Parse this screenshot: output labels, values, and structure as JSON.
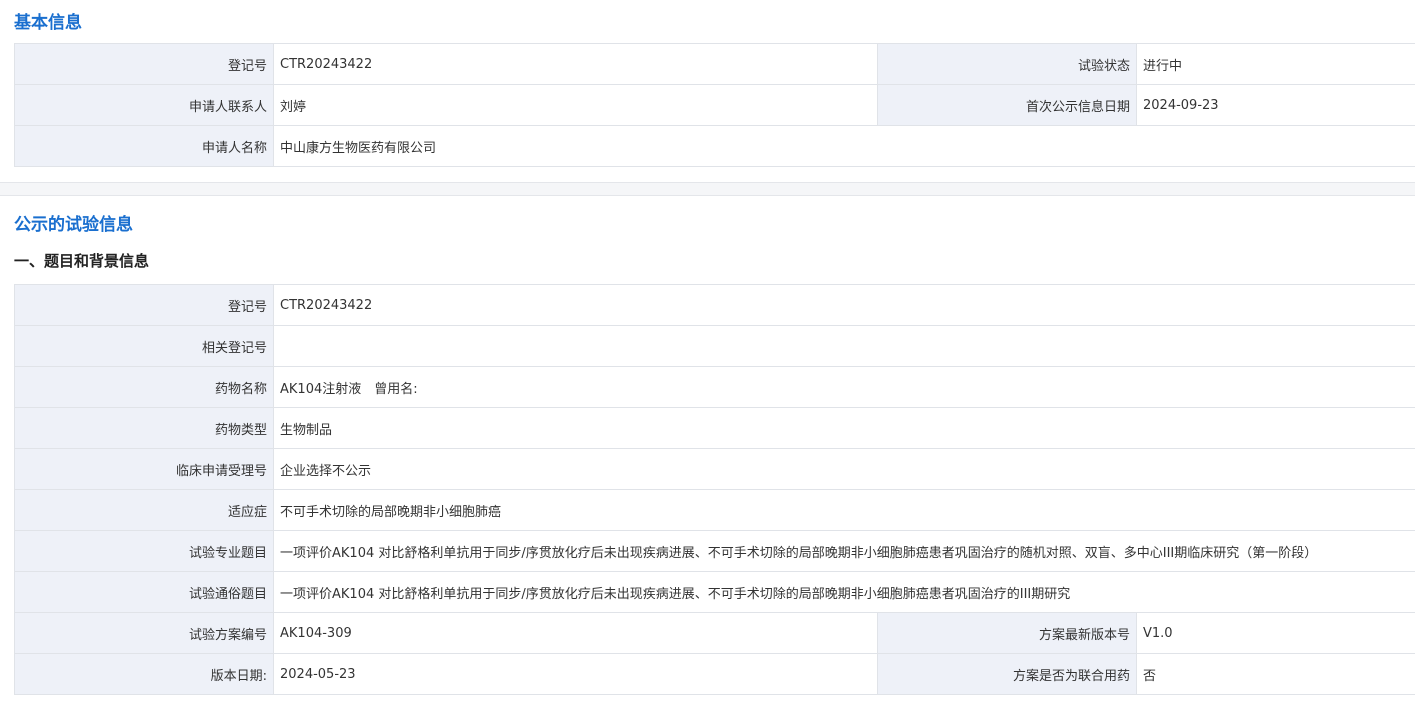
{
  "basic": {
    "title": "基本信息",
    "rows": [
      {
        "label": "登记号",
        "value": "CTR20243422",
        "label2": "试验状态",
        "value2": "进行中"
      },
      {
        "label": "申请人联系人",
        "value": "刘婷",
        "label2": "首次公示信息日期",
        "value2": "2024-09-23"
      },
      {
        "label": "申请人名称",
        "value": "中山康方生物医药有限公司"
      }
    ]
  },
  "trial": {
    "title": "公示的试验信息",
    "subtitle": "一、题目和背景信息",
    "rows": [
      {
        "label": "登记号",
        "value": "CTR20243422"
      },
      {
        "label": "相关登记号",
        "value": ""
      },
      {
        "label": "药物名称",
        "value": "AK104注射液　曾用名:"
      },
      {
        "label": "药物类型",
        "value": "生物制品"
      },
      {
        "label": "临床申请受理号",
        "value": "企业选择不公示"
      },
      {
        "label": "适应症",
        "value": "不可手术切除的局部晚期非小细胞肺癌"
      },
      {
        "label": "试验专业题目",
        "value": "一项评价AK104 对比舒格利单抗用于同步/序贯放化疗后未出现疾病进展、不可手术切除的局部晚期非小细胞肺癌患者巩固治疗的随机对照、双盲、多中心III期临床研究（第一阶段）"
      },
      {
        "label": "试验通俗题目",
        "value": "一项评价AK104 对比舒格利单抗用于同步/序贯放化疗后未出现疾病进展、不可手术切除的局部晚期非小细胞肺癌患者巩固治疗的III期研究"
      },
      {
        "label": "试验方案编号",
        "value": "AK104-309",
        "label2": "方案最新版本号",
        "value2": "V1.0"
      },
      {
        "label": "版本日期:",
        "value": "2024-05-23",
        "label2": "方案是否为联合用药",
        "value2": "否"
      }
    ]
  }
}
